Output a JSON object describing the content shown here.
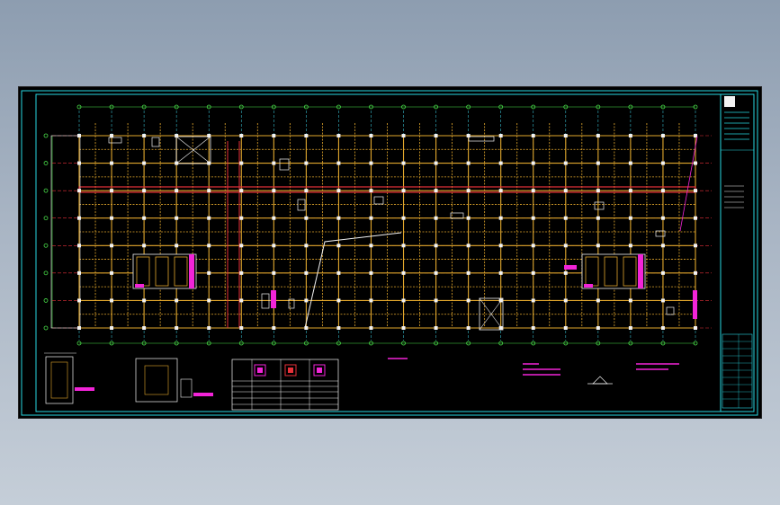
{
  "window": {
    "title": ""
  },
  "drawing": {
    "colors": {
      "frame": "#27d8e2",
      "axis_h": "#e8313a",
      "axis_v": "#36b7c8",
      "beam": "#e2a72c",
      "grid_bubble": "#4ae04a",
      "column": "#f2f2f2",
      "text": "#e6e6e6",
      "highlight": "#f224d8",
      "sheet_bg": "#000000"
    },
    "plan_axis_count_vertical": 20,
    "plan_axis_count_horizontal": 8,
    "schedule_table": {
      "rows": 6,
      "columns": 4
    }
  }
}
